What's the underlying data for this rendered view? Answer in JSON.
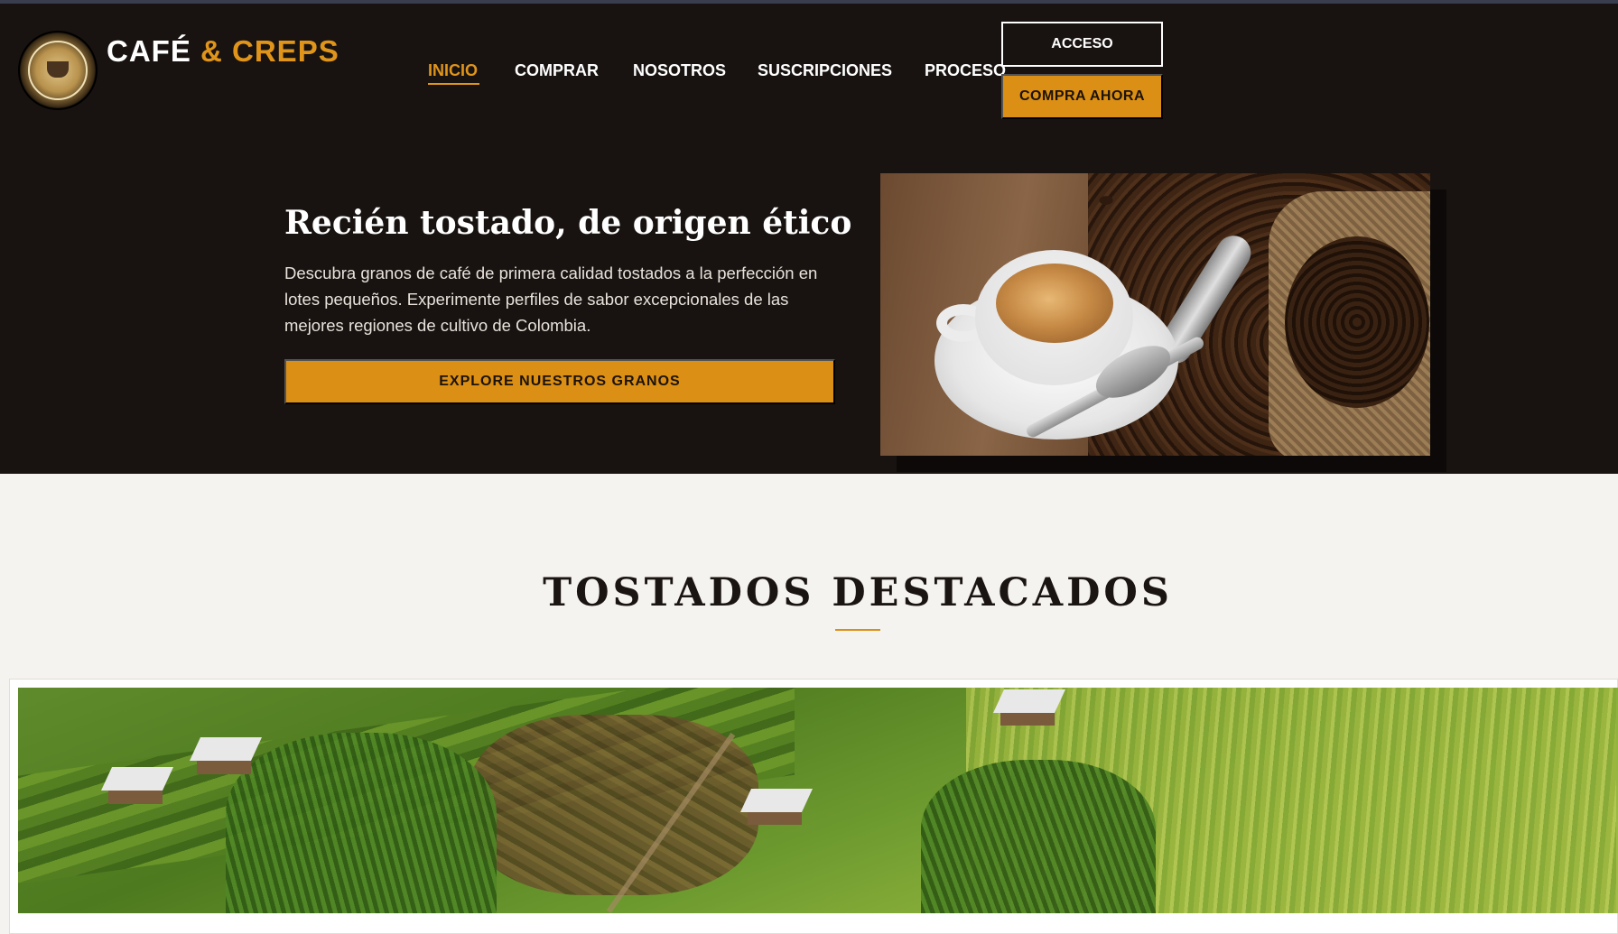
{
  "header": {
    "brand": {
      "name": "CAFÉ",
      "accent": "& CREPS"
    },
    "nav": [
      {
        "label": "INICIO",
        "active": true
      },
      {
        "label": "COMPRAR",
        "active": false
      },
      {
        "label": "NOSOTROS",
        "active": false
      },
      {
        "label": "SUSCRIPCIONES",
        "active": false
      },
      {
        "label": "PROCESO",
        "active": false
      }
    ],
    "login_label": "ACCESO",
    "buy_now_label": "COMPRA AHORA"
  },
  "hero": {
    "title": "Recién tostado, de origen ético",
    "description": "Descubra granos de café de primera calidad tostados a la perfección en lotes pequeños. Experimente perfiles de sabor excepcionales de las mejores regiones de cultivo de Colombia.",
    "cta_label": "EXPLORE NUESTROS GRANOS"
  },
  "featured": {
    "title": "TOSTADOS DESTACADOS"
  },
  "colors": {
    "accent": "#db8f14",
    "dark_bg": "#181311",
    "light_bg": "#f5f3ef"
  }
}
